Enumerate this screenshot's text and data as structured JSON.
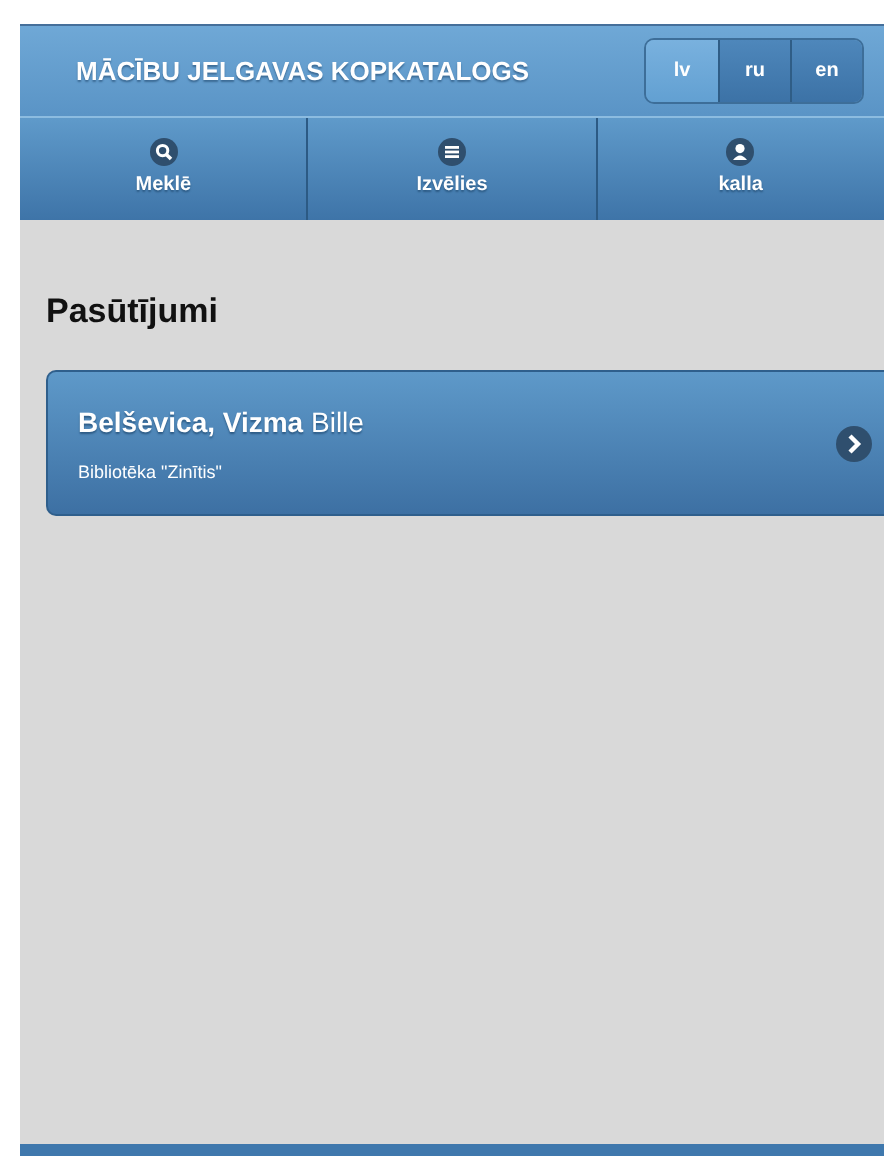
{
  "header": {
    "title": "MĀCĪBU JELGAVAS KOPKATALOGS",
    "languages": [
      {
        "label": "lv",
        "selected": true
      },
      {
        "label": "ru",
        "selected": false
      },
      {
        "label": "en",
        "selected": false
      }
    ]
  },
  "navbar": [
    {
      "label": "Meklē",
      "kind": "search"
    },
    {
      "label": "Izvēlies",
      "kind": "menu"
    },
    {
      "label": "kalla",
      "kind": "user"
    }
  ],
  "page": {
    "heading": "Pasūtījumi",
    "orders": [
      {
        "title": "**Belševica, Vizma** Bille",
        "library": "Bibliotēka \"Zinītis\""
      }
    ]
  }
}
